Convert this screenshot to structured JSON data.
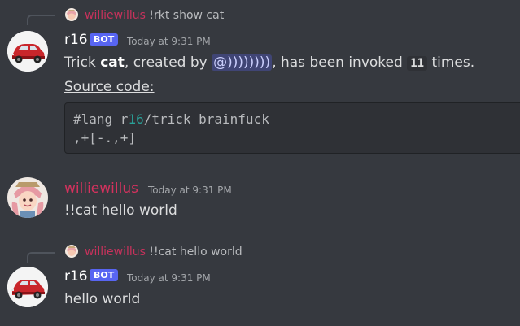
{
  "colors": {
    "background": "#36393f",
    "username_user": "#d4325e",
    "bot_tag": "#5865f2"
  },
  "messages": [
    {
      "reply": {
        "author": "williewillus",
        "text": "!rkt show cat"
      },
      "author": "r16",
      "bot_tag": "BOT",
      "timestamp": "Today at 9:31 PM",
      "content": {
        "prefix": "Trick ",
        "trick_name": "cat",
        "middle": ", created by ",
        "mention": "@))))))))",
        "after_mention": ", has been invoked ",
        "count": "11",
        "suffix": " times.",
        "source_label": "Source code:",
        "code_line1_a": "#lang r",
        "code_line1_num": "16",
        "code_line1_b": "/trick brainfuck",
        "code_line2": ",+[-.,+]"
      }
    },
    {
      "author": "williewillus",
      "timestamp": "Today at 9:31 PM",
      "text": "!!cat hello world"
    },
    {
      "reply": {
        "author": "williewillus",
        "text": "!!cat hello world"
      },
      "author": "r16",
      "bot_tag": "BOT",
      "timestamp": "Today at 9:31 PM",
      "text": "hello world"
    }
  ]
}
